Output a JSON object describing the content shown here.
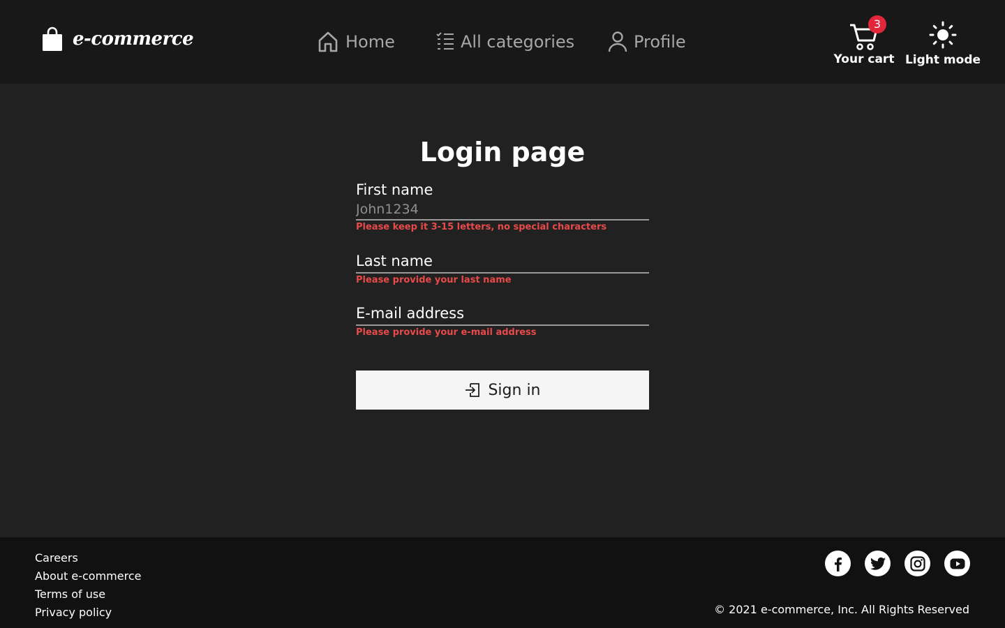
{
  "header": {
    "logo_text": "e-commerce",
    "logo_icon": "shopping-bag-icon",
    "nav": {
      "home": "Home",
      "categories": "All categories",
      "profile": "Profile"
    },
    "cart": {
      "label": "Your cart",
      "count": "3",
      "icon": "cart-icon",
      "badge_color": "#e2263c"
    },
    "theme_toggle": {
      "label": "Light mode",
      "icon": "sun-icon"
    }
  },
  "main": {
    "title": "Login page",
    "fields": {
      "first_name": {
        "label": "First name",
        "placeholder": "John1234",
        "value": "",
        "error": "Please keep it 3-15 letters, no special characters"
      },
      "last_name": {
        "label": "Last name",
        "value": "",
        "error": "Please provide your last name"
      },
      "email": {
        "label": "E-mail address",
        "value": "",
        "error": "Please provide your e-mail address"
      }
    },
    "submit": {
      "label": "Sign in",
      "icon": "sign-in-icon"
    }
  },
  "footer": {
    "links": [
      "Careers",
      "About e-commerce",
      "Terms of use",
      "Privacy policy"
    ],
    "socials": [
      "facebook-icon",
      "twitter-icon",
      "instagram-icon",
      "youtube-icon"
    ],
    "copyright": "© 2021 e-commerce, Inc. All Rights Reserved"
  },
  "colors": {
    "header_bg": "#181818",
    "page_bg": "#212121",
    "footer_bg": "#111111",
    "error": "#e84a4a",
    "button_bg": "#f5f5f5"
  }
}
